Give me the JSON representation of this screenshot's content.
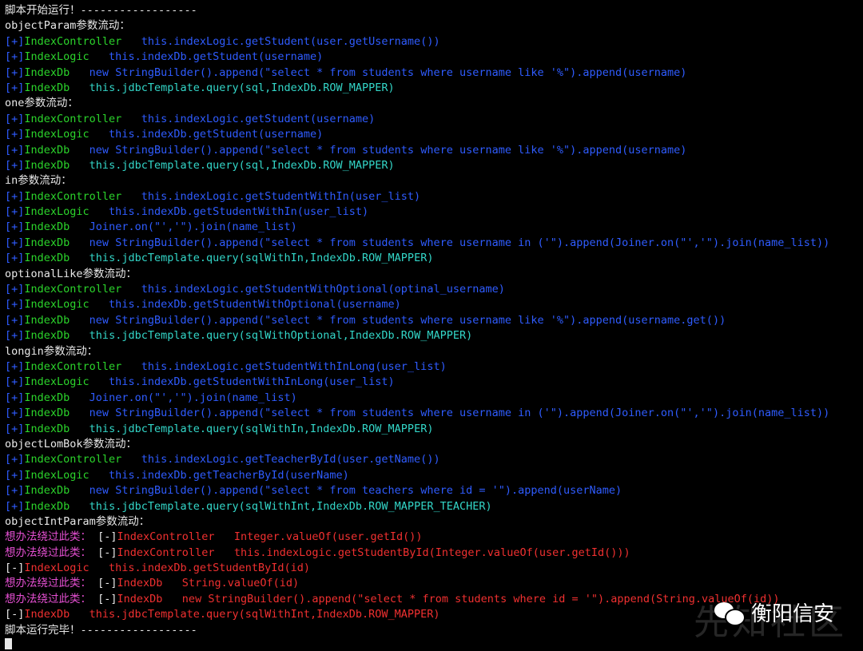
{
  "theme": {
    "background": "#000000",
    "colors": {
      "white": "#e8e8e8",
      "blue": "#2f5cff",
      "green": "#2bd42b",
      "cyan": "#33d6c8",
      "red": "#f03030",
      "magenta": "#e54fd2"
    }
  },
  "terminal": {
    "lines": [
      [
        [
          "w",
          "脚本开始运行！------------------"
        ]
      ],
      [
        [
          "w",
          "objectParam参数流动："
        ]
      ],
      [
        [
          "b",
          "[+]"
        ],
        [
          "g",
          "IndexController"
        ],
        [
          "b",
          "   this.indexLogic.getStudent(user.getUsername())"
        ]
      ],
      [
        [
          "b",
          "[+]"
        ],
        [
          "g",
          "IndexLogic"
        ],
        [
          "b",
          "   this.indexDb.getStudent(username)"
        ]
      ],
      [
        [
          "b",
          "[+]"
        ],
        [
          "g",
          "IndexDb"
        ],
        [
          "b",
          "   new StringBuilder().append(\"select * from students where username like '%\").append(username)"
        ]
      ],
      [
        [
          "b",
          "[+]"
        ],
        [
          "g",
          "IndexDb"
        ],
        [
          "c",
          "   this.jdbcTemplate.query(sql,IndexDb.ROW_MAPPER)"
        ]
      ],
      [
        [
          "w",
          "one参数流动："
        ]
      ],
      [
        [
          "b",
          "[+]"
        ],
        [
          "g",
          "IndexController"
        ],
        [
          "b",
          "   this.indexLogic.getStudent(username)"
        ]
      ],
      [
        [
          "b",
          "[+]"
        ],
        [
          "g",
          "IndexLogic"
        ],
        [
          "b",
          "   this.indexDb.getStudent(username)"
        ]
      ],
      [
        [
          "b",
          "[+]"
        ],
        [
          "g",
          "IndexDb"
        ],
        [
          "b",
          "   new StringBuilder().append(\"select * from students where username like '%\").append(username)"
        ]
      ],
      [
        [
          "b",
          "[+]"
        ],
        [
          "g",
          "IndexDb"
        ],
        [
          "c",
          "   this.jdbcTemplate.query(sql,IndexDb.ROW_MAPPER)"
        ]
      ],
      [
        [
          "w",
          "in参数流动："
        ]
      ],
      [
        [
          "b",
          "[+]"
        ],
        [
          "g",
          "IndexController"
        ],
        [
          "b",
          "   this.indexLogic.getStudentWithIn(user_list)"
        ]
      ],
      [
        [
          "b",
          "[+]"
        ],
        [
          "g",
          "IndexLogic"
        ],
        [
          "b",
          "   this.indexDb.getStudentWithIn(user_list)"
        ]
      ],
      [
        [
          "b",
          "[+]"
        ],
        [
          "g",
          "IndexDb"
        ],
        [
          "b",
          "   Joiner.on(\"','\").join(name_list)"
        ]
      ],
      [
        [
          "b",
          "[+]"
        ],
        [
          "g",
          "IndexDb"
        ],
        [
          "b",
          "   new StringBuilder().append(\"select * from students where username in ('\").append(Joiner.on(\"','\").join(name_list))"
        ]
      ],
      [
        [
          "b",
          "[+]"
        ],
        [
          "g",
          "IndexDb"
        ],
        [
          "c",
          "   this.jdbcTemplate.query(sqlWithIn,IndexDb.ROW_MAPPER)"
        ]
      ],
      [
        [
          "w",
          "optionalLike参数流动："
        ]
      ],
      [
        [
          "b",
          "[+]"
        ],
        [
          "g",
          "IndexController"
        ],
        [
          "b",
          "   this.indexLogic.getStudentWithOptional(optinal_username)"
        ]
      ],
      [
        [
          "b",
          "[+]"
        ],
        [
          "g",
          "IndexLogic"
        ],
        [
          "b",
          "   this.indexDb.getStudentWithOptional(username)"
        ]
      ],
      [
        [
          "b",
          "[+]"
        ],
        [
          "g",
          "IndexDb"
        ],
        [
          "b",
          "   new StringBuilder().append(\"select * from students where username like '%\").append(username.get())"
        ]
      ],
      [
        [
          "b",
          "[+]"
        ],
        [
          "g",
          "IndexDb"
        ],
        [
          "c",
          "   this.jdbcTemplate.query(sqlWithOptional,IndexDb.ROW_MAPPER)"
        ]
      ],
      [
        [
          "w",
          "longin参数流动："
        ]
      ],
      [
        [
          "b",
          "[+]"
        ],
        [
          "g",
          "IndexController"
        ],
        [
          "b",
          "   this.indexLogic.getStudentWithInLong(user_list)"
        ]
      ],
      [
        [
          "b",
          "[+]"
        ],
        [
          "g",
          "IndexLogic"
        ],
        [
          "b",
          "   this.indexDb.getStudentWithInLong(user_list)"
        ]
      ],
      [
        [
          "b",
          "[+]"
        ],
        [
          "g",
          "IndexDb"
        ],
        [
          "b",
          "   Joiner.on(\"','\").join(name_list)"
        ]
      ],
      [
        [
          "b",
          "[+]"
        ],
        [
          "g",
          "IndexDb"
        ],
        [
          "b",
          "   new StringBuilder().append(\"select * from students where username in ('\").append(Joiner.on(\"','\").join(name_list))"
        ]
      ],
      [
        [
          "b",
          "[+]"
        ],
        [
          "g",
          "IndexDb"
        ],
        [
          "c",
          "   this.jdbcTemplate.query(sqlWithIn,IndexDb.ROW_MAPPER)"
        ]
      ],
      [
        [
          "w",
          "objectLomBok参数流动："
        ]
      ],
      [
        [
          "b",
          "[+]"
        ],
        [
          "g",
          "IndexController"
        ],
        [
          "b",
          "   this.indexLogic.getTeacherById(user.getName())"
        ]
      ],
      [
        [
          "b",
          "[+]"
        ],
        [
          "g",
          "IndexLogic"
        ],
        [
          "b",
          "   this.indexDb.getTeacherById(userName)"
        ]
      ],
      [
        [
          "b",
          "[+]"
        ],
        [
          "g",
          "IndexDb"
        ],
        [
          "b",
          "   new StringBuilder().append(\"select * from teachers where id = '\").append(userName)"
        ]
      ],
      [
        [
          "b",
          "[+]"
        ],
        [
          "g",
          "IndexDb"
        ],
        [
          "c",
          "   this.jdbcTemplate.query(sqlWithInt,IndexDb.ROW_MAPPER_TEACHER)"
        ]
      ],
      [
        [
          "w",
          "objectIntParam参数流动："
        ]
      ],
      [
        [
          "m",
          "想办法绕过此类： "
        ],
        [
          "w",
          "[-]"
        ],
        [
          "r",
          "IndexController   Integer.valueOf(user.getId())"
        ]
      ],
      [
        [
          "m",
          "想办法绕过此类： "
        ],
        [
          "w",
          "[-]"
        ],
        [
          "r",
          "IndexController   this.indexLogic.getStudentById(Integer.valueOf(user.getId()))"
        ]
      ],
      [
        [
          "w",
          "[-]"
        ],
        [
          "r",
          "IndexLogic   this.indexDb.getStudentById(id)"
        ]
      ],
      [
        [
          "m",
          "想办法绕过此类： "
        ],
        [
          "w",
          "[-]"
        ],
        [
          "r",
          "IndexDb   String.valueOf(id)"
        ]
      ],
      [
        [
          "m",
          "想办法绕过此类： "
        ],
        [
          "w",
          "[-]"
        ],
        [
          "r",
          "IndexDb   new StringBuilder().append(\"select * from students where id = '\").append(String.valueOf(id))"
        ]
      ],
      [
        [
          "w",
          "[-]"
        ],
        [
          "r",
          "IndexDb   this.jdbcTemplate.query(sqlWithInt,IndexDb.ROW_MAPPER)"
        ]
      ],
      [
        [
          "w",
          "脚本运行完毕！------------------"
        ]
      ]
    ]
  },
  "watermark": {
    "brand_text": "衡阳信安",
    "background_text": "先知社区",
    "icon": "wechat-icon"
  }
}
